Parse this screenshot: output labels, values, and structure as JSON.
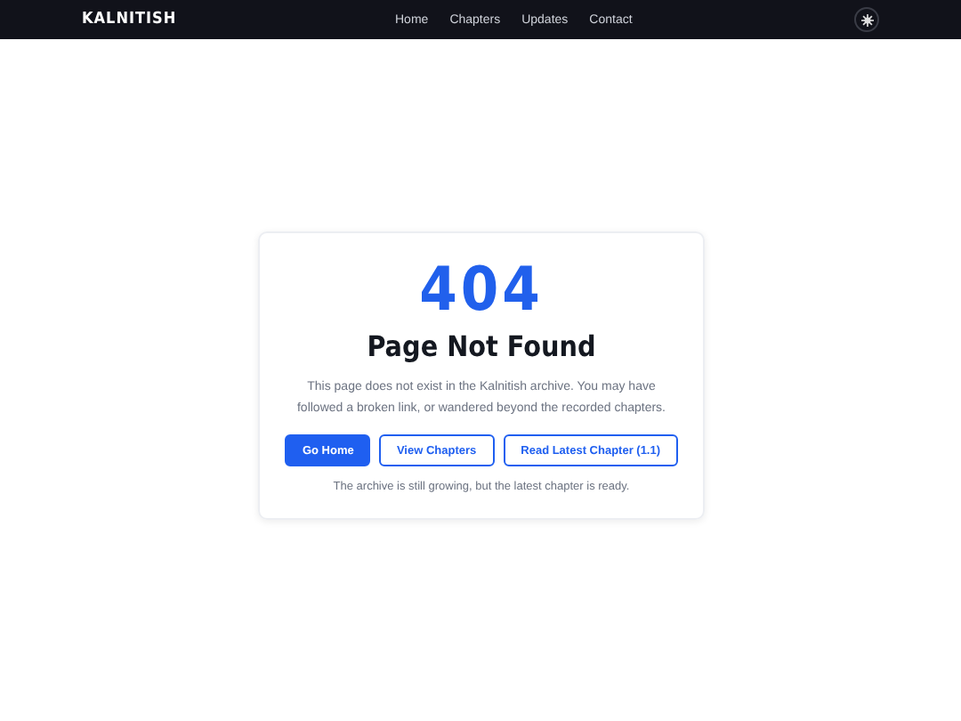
{
  "navbar": {
    "brand": "KALNITISH",
    "links": [
      "Home",
      "Chapters",
      "Updates",
      "Contact"
    ]
  },
  "error_card": {
    "code": "404",
    "title": "Page Not Found",
    "message": "This page does not exist in the Kalnitish archive. You may have followed a broken link, or wandered beyond the recorded chapters.",
    "buttons": [
      {
        "label": "Go Home",
        "kind": "primary"
      },
      {
        "label": "View Chapters",
        "kind": "outline"
      },
      {
        "label": "Read Latest Chapter (1.1)",
        "kind": "outline"
      }
    ],
    "note": "The archive is still growing, but the latest chapter is ready."
  }
}
